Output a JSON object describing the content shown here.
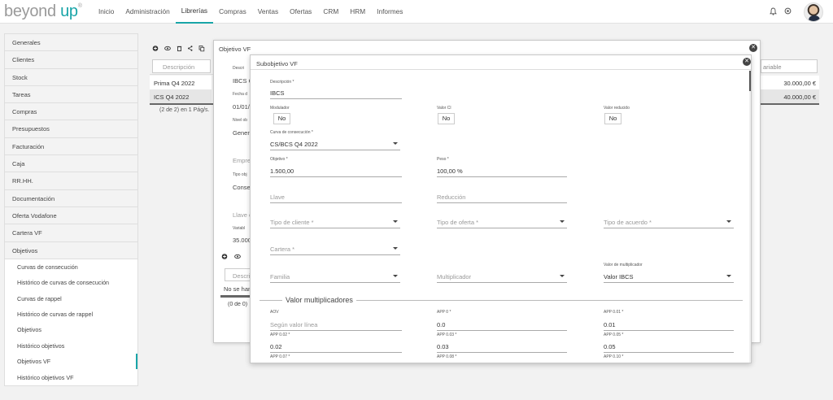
{
  "logo": {
    "text_a": "beyond ",
    "text_b": "up",
    "sup": "®"
  },
  "nav": [
    "Inicio",
    "Administración",
    "Librerías",
    "Compras",
    "Ventas",
    "Ofertas",
    "CRM",
    "HRM",
    "Informes"
  ],
  "sidebar": {
    "items": [
      "Generales",
      "Clientes",
      "Stock",
      "Tareas",
      "Compras",
      "Presupuestos",
      "Facturación",
      "Caja",
      "RR.HH.",
      "Documentación",
      "Oferta Vodafone",
      "Cartera VF",
      "Objetivos"
    ],
    "subitems": [
      "Curvas de consecución",
      "Histórico de curvas de consecución",
      "Curvas de rappel",
      "Histórico de curvas de rappel",
      "Objetivos",
      "Histórico objetivos",
      "Objetivos VF",
      "Histórico objetivos VF"
    ]
  },
  "background": {
    "search_placeholder": "Descripción",
    "rows": [
      "Prima Q4 2022",
      "ICS Q4 2022"
    ],
    "pagination": "(2 de 2) en 1 Pág/s.",
    "right_header": "ariable",
    "right_values": [
      "30.000,00 €",
      "40.000,00 €"
    ]
  },
  "mid_window": {
    "title": "Objetivo VF",
    "fragments": [
      "Descri",
      "IBCS C",
      "Fecha d",
      "01/01/",
      "Nivel ob",
      "Gener",
      "Empre",
      "Tipo obj",
      "Conse",
      "Llave ç",
      "Variabl",
      "35.000",
      "Descrip",
      "No se han",
      "(0 de 0)"
    ]
  },
  "front_window": {
    "title": "Subobjetivo VF",
    "descripcion_label": "Descripción *",
    "descripcion_value": "IBCS",
    "modulador_label": "Modulador",
    "valor_ci_label": "Valor CI",
    "valor_reducido_label": "Valor reducido",
    "no_label": "No",
    "curva_label": "Curva de consecución *",
    "curva_value": "CS/BCS Q4 2022",
    "objetivo_label": "Objetivo *",
    "objetivo_value": "1.500,00",
    "peso_label": "Peso *",
    "peso_value": "100,00 %",
    "llave_placeholder": "Llave",
    "reduccion_placeholder": "Reducción",
    "tipo_cliente_placeholder": "Tipo de cliente *",
    "tipo_oferta_placeholder": "Tipo de oferta *",
    "tipo_acuerdo_placeholder": "Tipo de acuerdo *",
    "cartera_placeholder": "Cartera *",
    "familia_placeholder": "Familia",
    "multiplicador_placeholder": "Multiplicador",
    "valor_mult_label": "Valor de multiplicador",
    "valor_mult_value": "Valor IBCS",
    "section_title": "Valor multiplicadores",
    "aov_label": "AOV",
    "aov_placeholder": "Según valor línea",
    "app0_label": "APP 0 *",
    "app0_value": "0.0",
    "app001_label": "APP 0.01 *",
    "app001_value": "0.01",
    "app002_label": "APP 0.02 *",
    "app002_value": "0.02",
    "app003_label": "APP 0.03 *",
    "app003_value": "0.03",
    "app005_label": "APP 0.05 *",
    "app005_value": "0.05",
    "next_row_labels": [
      "APP 0.07 *",
      "APP 0.08 *",
      "APP 0.10 *"
    ]
  }
}
